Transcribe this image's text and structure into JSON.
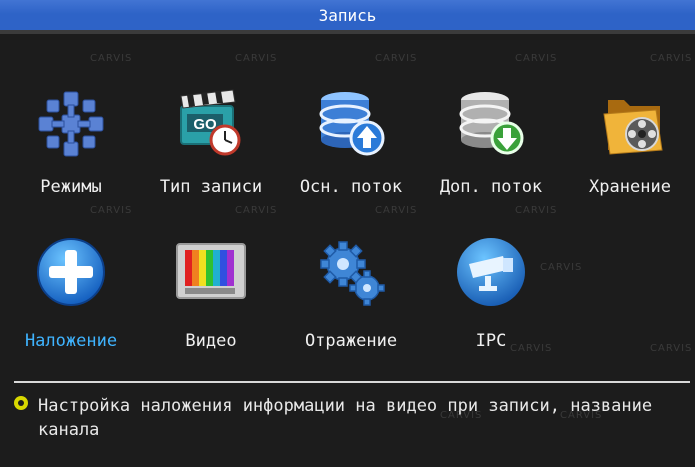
{
  "window": {
    "title": "Запись"
  },
  "menu": {
    "items": [
      {
        "label": "Режимы",
        "icon": "snowflake-cubes-icon",
        "active": false
      },
      {
        "label": "Тип записи",
        "icon": "clapperboard-clock-icon",
        "active": false
      },
      {
        "label": "Осн. поток",
        "icon": "database-upload-icon",
        "active": false
      },
      {
        "label": "Доп. поток",
        "icon": "database-download-icon",
        "active": false
      },
      {
        "label": "Хранение",
        "icon": "folder-film-reel-icon",
        "active": false
      },
      {
        "label": "Наложение",
        "icon": "plus-circle-icon",
        "active": true
      },
      {
        "label": "Видео",
        "icon": "tv-color-bars-icon",
        "active": false
      },
      {
        "label": "Отражение",
        "icon": "gears-icon",
        "active": false
      },
      {
        "label": "IPC",
        "icon": "security-camera-icon",
        "active": false
      }
    ]
  },
  "hint": {
    "text": "Настройка наложения информации на видео при записи, название канала"
  },
  "watermark": {
    "text": "CARVIS"
  },
  "colors": {
    "title_bar": "#2e63c7",
    "active_label": "#3fb4ff",
    "hint_bullet": "#d8d800"
  }
}
